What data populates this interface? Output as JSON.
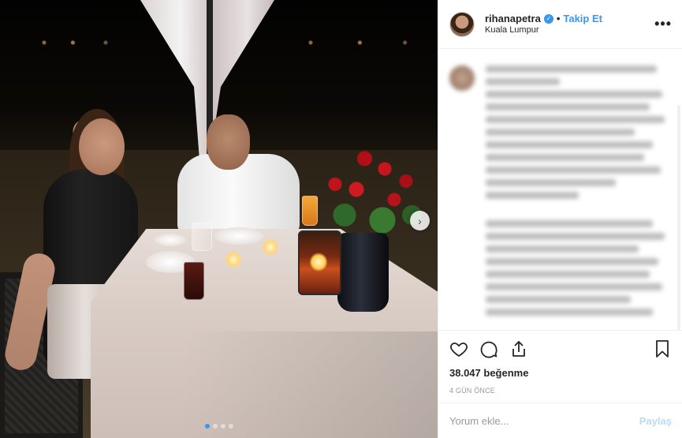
{
  "post": {
    "photo_alt": "",
    "carousel": {
      "dots": 4,
      "active": 0
    }
  },
  "header": {
    "username": "rihanapetra",
    "verified": true,
    "separator": "•",
    "follow_label": "Takip Et",
    "location": "Kuala Lumpur",
    "more_label": "•••"
  },
  "comments": {
    "blurred": true,
    "count_visible": 2
  },
  "actions": {
    "like_icon": "heart-icon",
    "comment_icon": "comment-icon",
    "share_icon": "share-icon",
    "save_icon": "bookmark-icon"
  },
  "likes_text": "38.047 beğenme",
  "time_text": "4 GÜN ÖNCE",
  "comment_box": {
    "placeholder": "Yorum ekle...",
    "post_label": "Paylaş"
  },
  "colors": {
    "accent": "#3897f0",
    "text": "#262626",
    "muted": "#999999",
    "post_disabled": "#b9dcfa"
  }
}
